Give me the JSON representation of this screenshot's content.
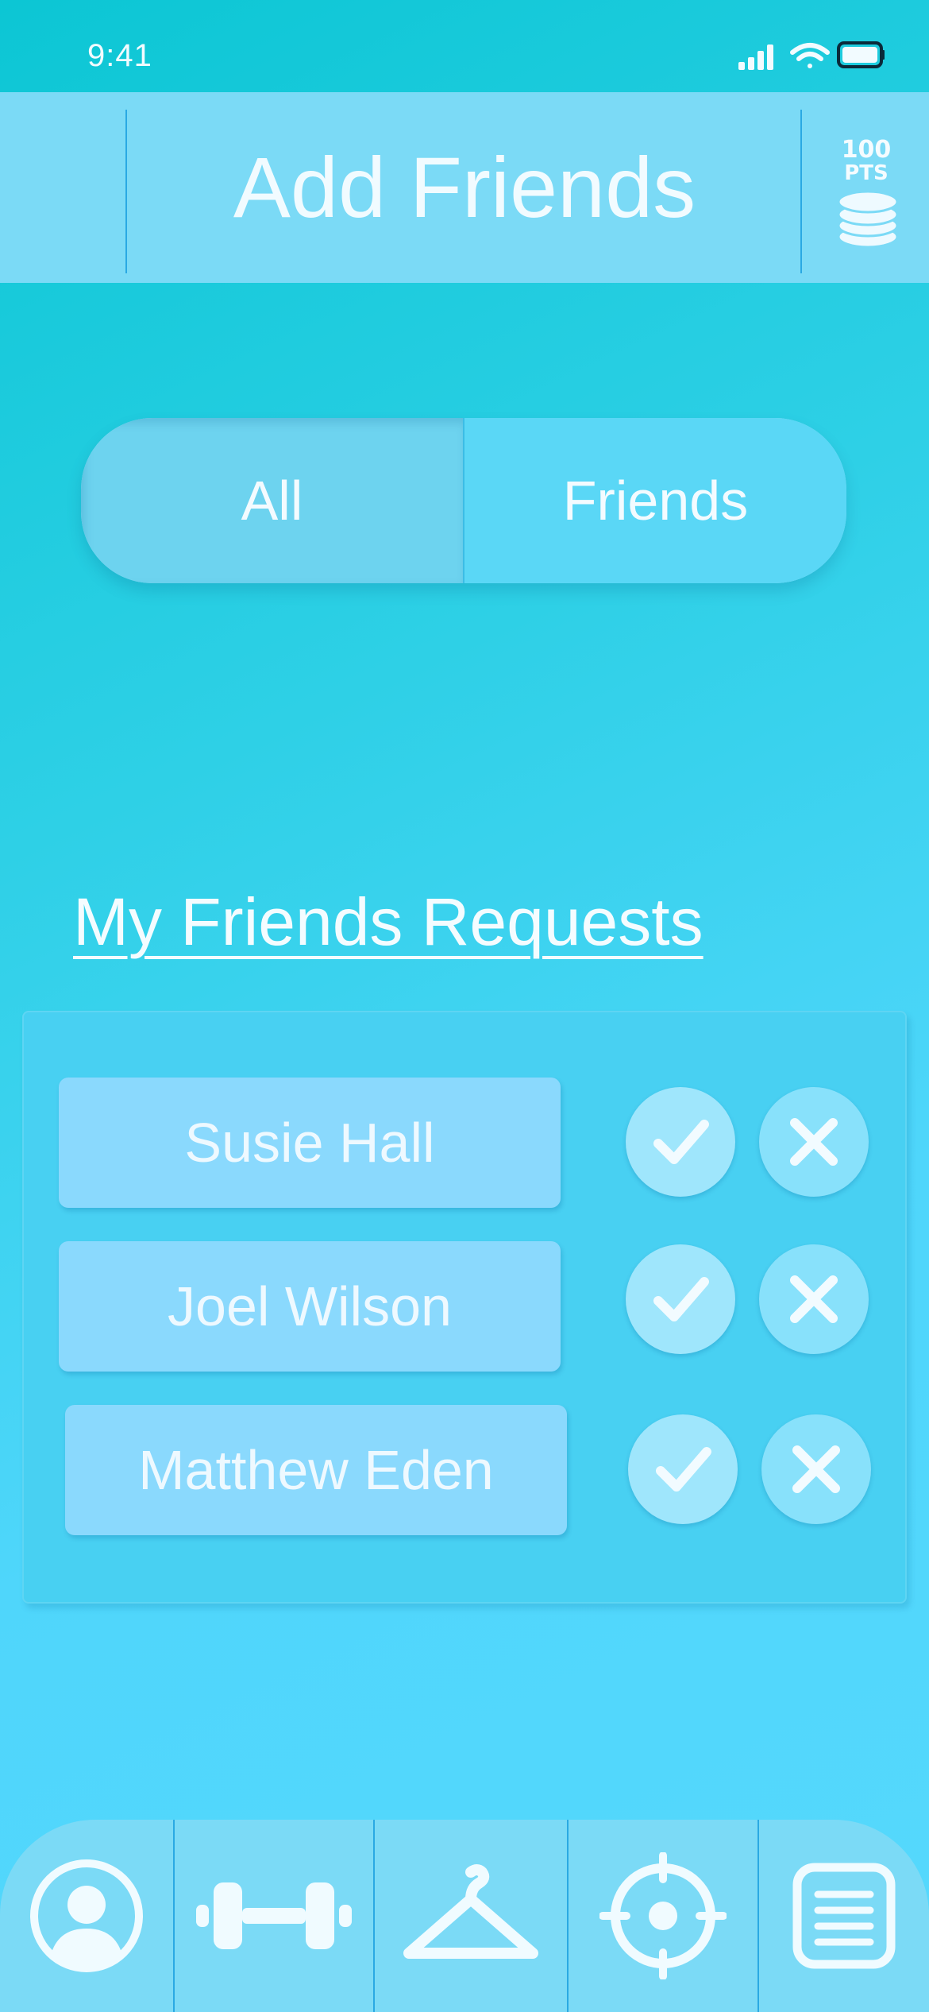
{
  "status_bar": {
    "time": "9:41"
  },
  "header": {
    "title": "Add Friends",
    "points_value": "100",
    "points_unit": "PTS"
  },
  "tabs": [
    {
      "label": "All",
      "selected": true
    },
    {
      "label": "Friends",
      "selected": false
    }
  ],
  "requests": {
    "title": "My Friends Requests",
    "items": [
      {
        "name": "Susie Hall"
      },
      {
        "name": "Joel Wilson"
      },
      {
        "name": "Matthew Eden"
      }
    ]
  },
  "bottom_nav": {
    "items": [
      {
        "icon": "profile-icon"
      },
      {
        "icon": "dumbbell-icon"
      },
      {
        "icon": "hanger-icon"
      },
      {
        "icon": "target-icon"
      },
      {
        "icon": "notes-icon"
      }
    ]
  },
  "colors": {
    "background_start": "#0cc6d4",
    "background_end": "#55d8fd",
    "header": "#7bdaf6",
    "divider": "#2aa9e3",
    "request_card": "#8ad9fd",
    "text": "#eaf9ff"
  }
}
